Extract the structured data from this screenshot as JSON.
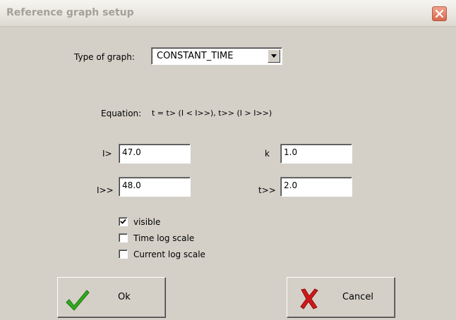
{
  "window": {
    "title": "Reference graph setup",
    "close_icon": "close-x-icon"
  },
  "graph_type": {
    "label": "Type of graph:",
    "selected": "CONSTANT_TIME"
  },
  "equation": {
    "label": "Equation:",
    "text": "t = t> (I < I>>),  t>> (I > I>>)"
  },
  "fields": {
    "i_gt": {
      "label": "I>",
      "value": "47.0"
    },
    "i_gtgt": {
      "label": "I>>",
      "value": "48.0"
    },
    "k": {
      "label": "k",
      "value": "1.0"
    },
    "t_gtgt": {
      "label": "t>>",
      "value": "2.0"
    }
  },
  "options": [
    {
      "label": "visible",
      "checked": true
    },
    {
      "label": "Time log scale",
      "checked": false
    },
    {
      "label": "Current log scale",
      "checked": false
    }
  ],
  "buttons": {
    "ok": {
      "label": "Ok",
      "icon": "checkmark-icon",
      "icon_color": "#2fae1c"
    },
    "cancel": {
      "label": "Cancel",
      "icon": "red-x-icon",
      "icon_color": "#d01818"
    }
  }
}
